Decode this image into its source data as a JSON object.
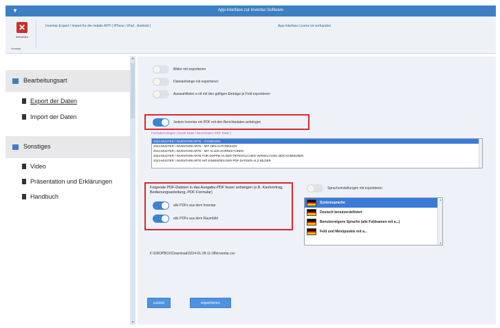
{
  "window": {
    "title": "App-Interface zur Inventur-Software",
    "icon": "app-menu-icon"
  },
  "ribbon": {
    "close_label": "Abmelden",
    "group_label": "Anzeige",
    "breadcrumb": "Inventar-Export / Import für die mobile APP ( iPhone / iPad , Android )",
    "info": "App-Interface Lizenz ist vorhanden"
  },
  "sidebar": {
    "sections": [
      {
        "label": "Bearbeitungsart",
        "items": [
          "Export der Daten",
          "Import  der Daten"
        ]
      },
      {
        "label": "Sonstiges",
        "items": [
          "Video",
          "Präsentation und Erklärungen",
          "Handbuch"
        ]
      }
    ]
  },
  "main": {
    "toggles": [
      {
        "label": "Bilder mit exportieren",
        "on": false
      },
      {
        "label": "Dateianhänge mit exportieren",
        "on": false
      },
      {
        "label": "Auswahllisten a nit mit den gültigen Einträge je Feld exportieren",
        "on": false
      },
      {
        "label": "Jedem Inventar ein PDF mit den Berichtsdaten anhängen",
        "on": true
      }
    ],
    "template_header": "Formularvorlagen ( Excel-Datei / Word-Datei / PDF Datei )",
    "templates": [
      "2024-MUSTER / INVENTARKARTE - STANDARD",
      "2024-MUSTER / INVENTARKARTE - MIT DEN AUTOREIHEN",
      "2024-MUSTER / INVENTARKARTE - MIT ALLEN KORREKTUREN",
      "2024-MUSTER / INVENTARKARTE FÜR DOPPIK IN DER ÖFFENTLICHEN VERWALTUNG DER KOMMUNEN",
      "2024-MUSTER / INVENTARKARTE MIT EINBINDEN DER PDF-DATEIEN ALS BILDER"
    ],
    "pdf_note": "Folgende PDF-Dateien in das Ausgabe-PDF fesen anhängen (z.B. Kaufvertrag, Bedienungsanleitung, PDF Formular)",
    "pdf_toggles": [
      {
        "label": "alle PDFs aus dem Inventar",
        "on": true
      },
      {
        "label": "alle PDFs aus dem Raumbild",
        "on": true
      }
    ],
    "language_toggle": {
      "label": "Spracheinstellungen mit exportieren",
      "on": false
    },
    "languages": [
      "Systemsprache",
      "Deutsch benutzerdefiniert",
      "Benutzereigene Sprache (alle Feldnamen mit a...)",
      "Feld und Menüpunkte mit a..."
    ],
    "export_path": "F:\\DROPBOX\\Download\\2024-01-28-11-08\\Inventar.csv",
    "buttons": {
      "back": "zurück",
      "export": "exportieren"
    }
  },
  "colors": {
    "title_bar": "#3d7fc4",
    "accent": "#3a84d6",
    "highlight_box": "#d9262b",
    "close_button": "#c9302c"
  }
}
